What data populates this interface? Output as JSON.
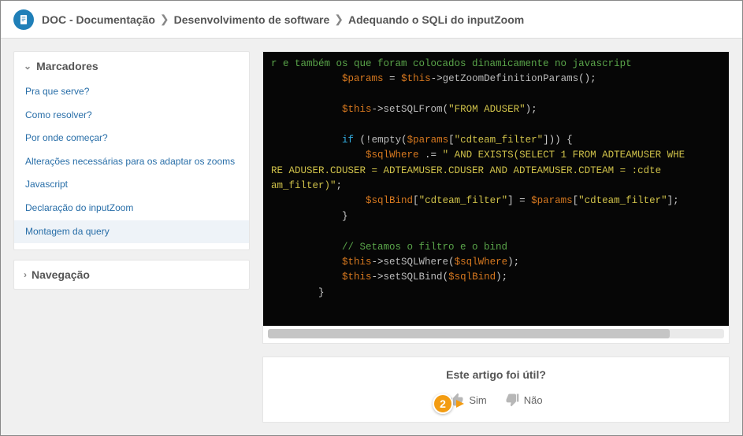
{
  "header": {
    "breadcrumbs": [
      "DOC - Documentação",
      "Desenvolvimento de software",
      "Adequando o SQLi do inputZoom"
    ]
  },
  "sidebar": {
    "markers": {
      "title": "Marcadores",
      "links": [
        "Pra que serve?",
        "Como resolver?",
        "Por onde começar?",
        "Alterações necessárias para os adaptar os zooms",
        "Javascript",
        "Declaração do inputZoom",
        "Montagem da query"
      ],
      "active_index": 6
    },
    "navigation": {
      "title": "Navegação"
    }
  },
  "code": {
    "line_comment_wrap": "r e também os que foram colocados dinamicamente no javascript",
    "l1_var": "$params",
    "l1_thisvar": "$this",
    "l1_fn": "getZoomDefinitionParams",
    "l2_thisvar": "$this",
    "l2_fn": "setSQLFrom",
    "l2_str": "\"FROM ADUSER\"",
    "if_kw": "if",
    "empty_fn": "empty",
    "params_var": "$params",
    "cdteam_key": "\"cdteam_filter\"",
    "sqlwhere_var": "$sqlWhere",
    "op_concat": " .= ",
    "str_part1": "\" AND EXISTS(SELECT 1 FROM ADTEAMUSER WHE",
    "str_wrap2": "RE ADUSER.CDUSER = ADTEAMUSER.CDUSER AND ADTEAMUSER.CDTEAM = :cdte",
    "str_wrap3": "am_filter)\"",
    "sqlbind_var": "$sqlBind",
    "comment2": "// Setamos o filtro e o bind",
    "setwhere_fn": "setSQLWhere",
    "setbind_fn": "setSQLBind"
  },
  "feedback": {
    "title": "Este artigo foi útil?",
    "yes": "Sim",
    "no": "Não",
    "badge_number": "2"
  }
}
